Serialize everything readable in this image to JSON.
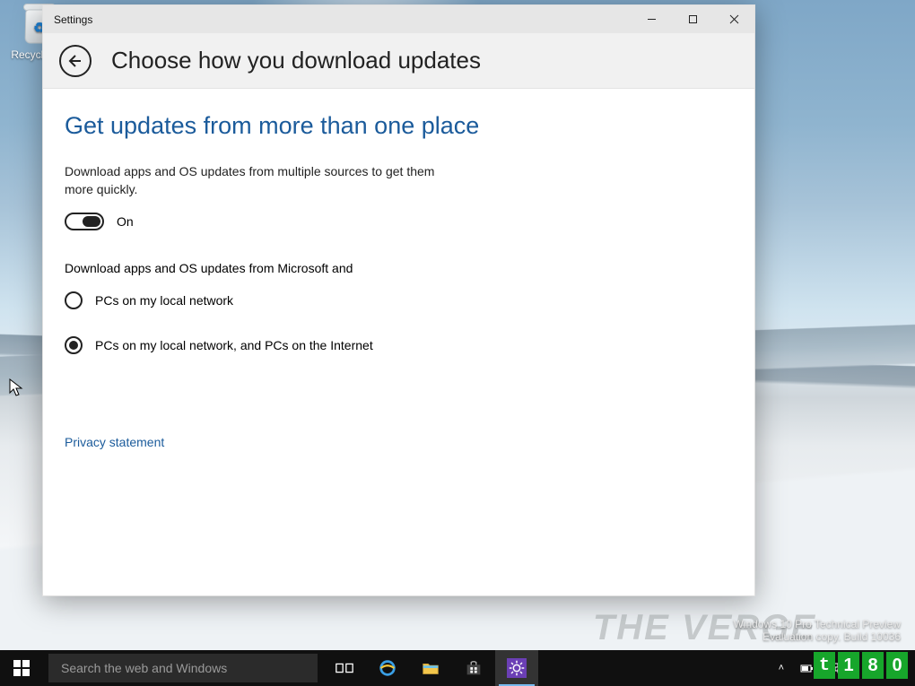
{
  "desktop": {
    "recycle_bin_label": "Recycle Bin"
  },
  "window": {
    "app_title": "Settings",
    "page_title": "Choose how you download updates",
    "section_heading": "Get updates from more than one place",
    "description": "Download apps and OS updates from multiple sources to get them more quickly.",
    "toggle": {
      "state": "on",
      "label": "On"
    },
    "source_intro": "Download apps and OS updates from Microsoft and",
    "radio_options": [
      {
        "id": "local",
        "label": "PCs on my local network",
        "checked": false
      },
      {
        "id": "internet",
        "label": "PCs on my local network, and PCs on the Internet",
        "checked": true
      }
    ],
    "privacy_link": "Privacy statement"
  },
  "taskbar": {
    "search_placeholder": "Search the web and Windows",
    "pinned": [
      {
        "id": "taskview",
        "name": "task-view-icon"
      },
      {
        "id": "ie",
        "name": "internet-explorer-icon"
      },
      {
        "id": "explorer",
        "name": "file-explorer-icon"
      },
      {
        "id": "store",
        "name": "store-icon"
      },
      {
        "id": "settings",
        "name": "settings-icon",
        "active": true
      }
    ],
    "tray": {
      "chevron": "˄",
      "items": [
        "power-icon",
        "network-icon",
        "volume-icon",
        "action-center-icon"
      ]
    }
  },
  "watermark": {
    "line1": "Windows 10 Pro Technical Preview",
    "line2": "Evaluation copy. Build 10036"
  },
  "corner_badge": [
    "t",
    "1",
    "8",
    "0"
  ],
  "verge_watermark": "THE VERGE"
}
